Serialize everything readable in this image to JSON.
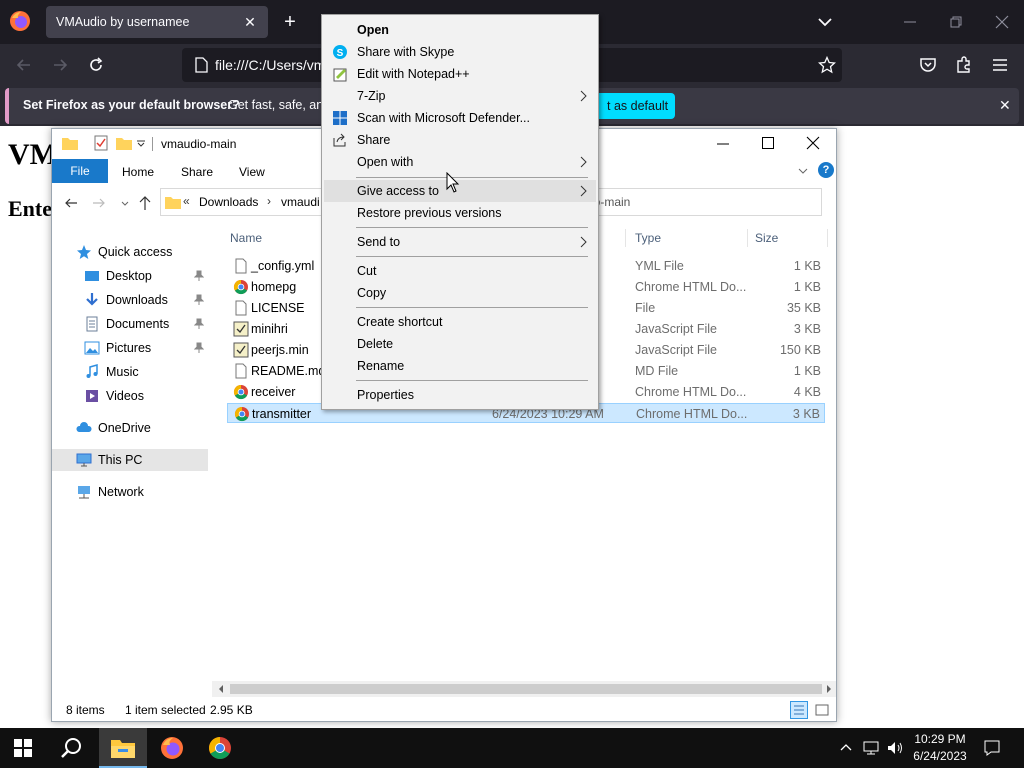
{
  "browser": {
    "tab_title": "VMAudio by usernamee",
    "tab_close": "✕",
    "new_tab": "+",
    "url": "file:///C:/Users/vm",
    "notification": {
      "strong": "Set Firefox as your default browser?",
      "sub": "Get fast, safe, and",
      "button": "t as default",
      "close": "✕"
    }
  },
  "webpage": {
    "heading1": "VM",
    "heading2": "Ente"
  },
  "explorer": {
    "title": "vmaudio-main",
    "ribbon": {
      "file": "File",
      "home": "Home",
      "share": "Share",
      "view": "View",
      "help": "?"
    },
    "address": {
      "crumb_prefix": "«",
      "crumb1": "Downloads",
      "sep": "›",
      "crumb2": "vmaudi",
      "search_suffix": "io-main"
    },
    "columns": {
      "name": "Name",
      "type": "Type",
      "size": "Size"
    },
    "nav": [
      {
        "label": "Quick access",
        "icon": "star-icon"
      },
      {
        "label": "Desktop",
        "icon": "desktop-icon"
      },
      {
        "label": "Downloads",
        "icon": "downloads-icon"
      },
      {
        "label": "Documents",
        "icon": "documents-icon"
      },
      {
        "label": "Pictures",
        "icon": "pictures-icon"
      },
      {
        "label": "Music",
        "icon": "music-icon"
      },
      {
        "label": "Videos",
        "icon": "videos-icon"
      },
      {
        "label": "OneDrive",
        "icon": "cloud-icon"
      },
      {
        "label": "This PC",
        "icon": "computer-icon"
      },
      {
        "label": "Network",
        "icon": "network-icon"
      }
    ],
    "files": [
      {
        "name": "_config.yml",
        "type": "YML File",
        "size": "1 KB",
        "date": "",
        "icon": "file-icon"
      },
      {
        "name": "homepg",
        "type": "Chrome HTML Do...",
        "size": "1 KB",
        "date": "",
        "icon": "chrome-icon"
      },
      {
        "name": "LICENSE",
        "type": "File",
        "size": "35 KB",
        "date": "",
        "icon": "file-icon"
      },
      {
        "name": "minihri",
        "type": "JavaScript File",
        "size": "3 KB",
        "date": "",
        "icon": "js-file-icon"
      },
      {
        "name": "peerjs.min",
        "type": "JavaScript File",
        "size": "150 KB",
        "date": "",
        "icon": "js-file-icon"
      },
      {
        "name": "README.md",
        "type": "MD File",
        "size": "1 KB",
        "date": "",
        "icon": "file-icon"
      },
      {
        "name": "receiver",
        "type": "Chrome HTML Do...",
        "size": "4 KB",
        "date": "",
        "icon": "chrome-icon"
      },
      {
        "name": "transmitter",
        "type": "Chrome HTML Do...",
        "size": "3 KB",
        "date": "6/24/2023 10:29 AM",
        "icon": "chrome-icon",
        "selected": true
      }
    ],
    "status": {
      "count": "8 items",
      "selected": "1 item selected",
      "size": "2.95 KB"
    }
  },
  "context_menu": {
    "items": [
      {
        "label": "Open",
        "bold": true
      },
      {
        "label": "Share with Skype",
        "icon": "skype-icon"
      },
      {
        "label": "Edit with Notepad++",
        "icon": "notepadpp-icon"
      },
      {
        "label": "7-Zip",
        "submenu": true
      },
      {
        "label": "Scan with Microsoft Defender...",
        "icon": "defender-icon"
      },
      {
        "label": "Share",
        "icon": "share-icon"
      },
      {
        "label": "Open with",
        "submenu": true
      },
      {
        "label": "Give access to",
        "submenu": true,
        "hover": true
      },
      {
        "label": "Restore previous versions"
      },
      {
        "label": "Send to",
        "submenu": true
      },
      {
        "label": "Cut"
      },
      {
        "label": "Copy"
      },
      {
        "label": "Create shortcut"
      },
      {
        "label": "Delete"
      },
      {
        "label": "Rename"
      },
      {
        "label": "Properties"
      }
    ]
  },
  "taskbar": {
    "time": "10:29 PM",
    "date": "6/24/2023"
  },
  "colors": {
    "firefox_dark": "#1c1b22",
    "explorer_accent": "#1979ca",
    "selection": "#cce8ff",
    "notif_button": "#00ddff"
  }
}
